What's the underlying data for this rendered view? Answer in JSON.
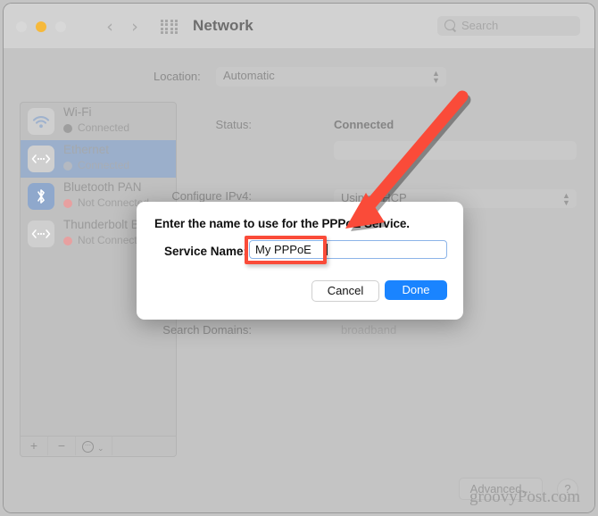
{
  "window": {
    "title": "Network",
    "traffic_lights": [
      "close-inactive",
      "minimize-yellow",
      "zoom-inactive"
    ],
    "search_placeholder": "Search"
  },
  "location_row": {
    "label": "Location:",
    "value": "Automatic"
  },
  "sidebar": {
    "services": [
      {
        "name": "Wi-Fi",
        "status": "Connected",
        "icon": "wifi-icon",
        "selected": false,
        "dot": "grey"
      },
      {
        "name": "Ethernet",
        "status": "Connected",
        "icon": "ethernet-icon",
        "selected": true,
        "dot": "grey"
      },
      {
        "name": "Bluetooth PAN",
        "status": "Not Connected",
        "icon": "bluetooth-icon",
        "selected": false,
        "dot": "red"
      },
      {
        "name": "Thunderbolt B",
        "status": "Not Connected",
        "icon": "ethernet-icon",
        "selected": false,
        "dot": "red"
      }
    ],
    "toolbar": {
      "add_label": "+",
      "remove_label": "−",
      "more_label": "⋯",
      "more_chevron": "⌄"
    }
  },
  "pane": {
    "status_label": "Status:",
    "status_value": "Connected",
    "configure_label": "Configure IPv4:",
    "configure_value": "Using DHCP",
    "search_domains_label": "Search Domains:",
    "search_domains_value": "broadband",
    "advanced_label": "Advanced...",
    "help_label": "?"
  },
  "sheet": {
    "title": "Enter the name to use for the PPPoE Service.",
    "field_label": "Service Name:",
    "field_value": "My PPPoE",
    "cancel_label": "Cancel",
    "done_label": "Done"
  },
  "annotations": {
    "arrow_color": "#fa4b39",
    "highlight_color": "#fa4b39",
    "watermark": "groovyPost.com"
  }
}
